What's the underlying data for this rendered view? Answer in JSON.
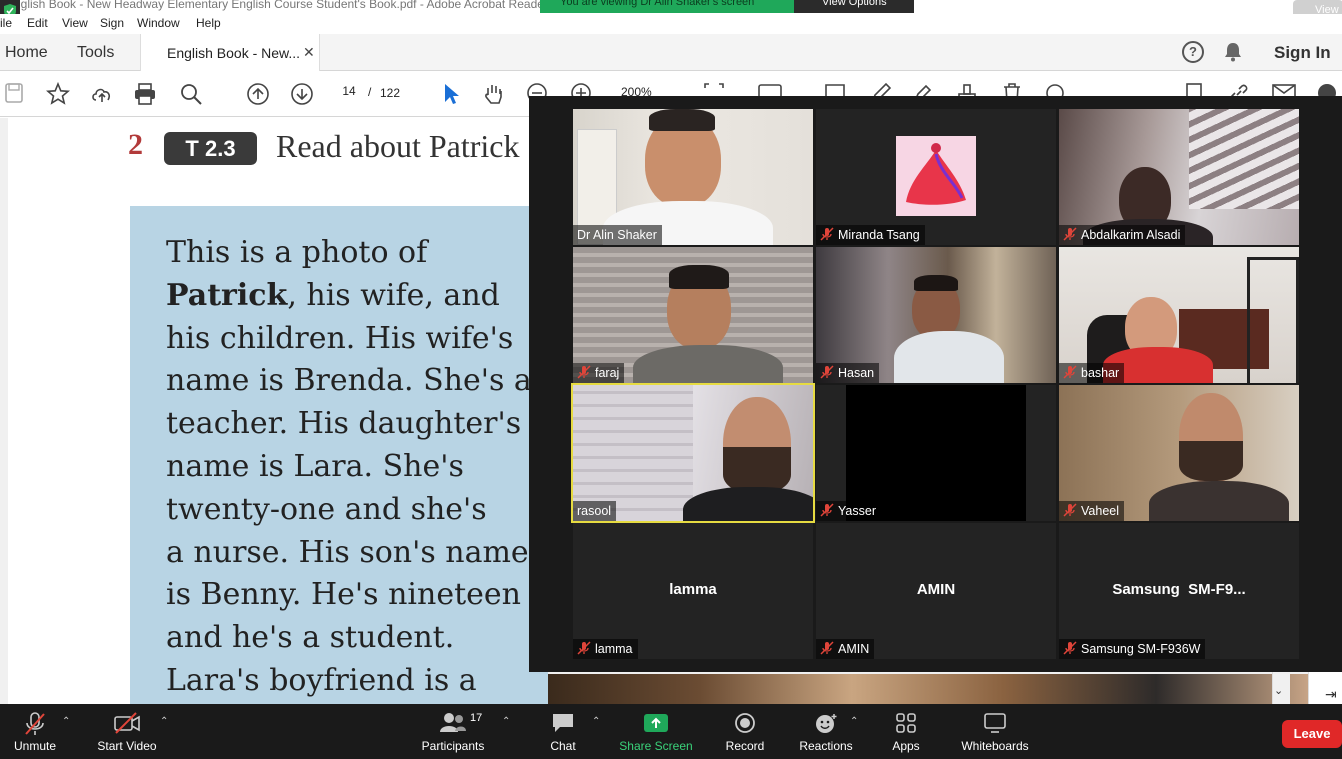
{
  "window": {
    "title": "English Book - New Headway Elementary English Course Student's Book.pdf - Adobe Acrobat Reader",
    "title_visible": "nglish Book - New Headway Elementary English Course Student's Book.pdf - Adobe Acrobat Reade"
  },
  "share_banner": {
    "text": "You are viewing Dr Alin Shaker's screen",
    "view_options": "View Options",
    "view_button": "View"
  },
  "menu": [
    "ile",
    "Edit",
    "View",
    "Sign",
    "Window",
    "Help"
  ],
  "tabs": {
    "home": "Home",
    "tools": "Tools",
    "document": "English Book - New...",
    "sign_in": "Sign In"
  },
  "toolbar": {
    "current_page": "14",
    "separator": "/",
    "total_pages": "122",
    "zoom": "200%"
  },
  "document": {
    "section_number": "2",
    "track": "T 2.3",
    "heading": "Read about Patrick",
    "reading_lines": [
      "This is a photo of",
      "Patrick, his wife, and",
      "his children. His wife's",
      "name is Brenda. She's a",
      "teacher. His daughter's",
      "name is Lara. She's",
      "twenty-one and she's",
      "a nurse. His son's name",
      "is Benny. He's nineteen",
      "and he's a student.",
      "Lara's boyfriend is a"
    ],
    "bold_word": "Patrick"
  },
  "gallery": {
    "participants": [
      {
        "name": "Dr Alin Shaker",
        "muted": false,
        "video": true,
        "active": false
      },
      {
        "name": "Miranda Tsang",
        "muted": true,
        "video": false,
        "avatar": true,
        "active": false
      },
      {
        "name": "Abdalkarim Alsadi",
        "muted": true,
        "video": true,
        "active": false
      },
      {
        "name": "faraj",
        "muted": true,
        "video": true,
        "active": false
      },
      {
        "name": "Hasan",
        "muted": true,
        "video": true,
        "active": false
      },
      {
        "name": "bashar",
        "muted": true,
        "video": true,
        "active": false
      },
      {
        "name": "rasool",
        "muted": false,
        "video": true,
        "active": true
      },
      {
        "name": "Yasser",
        "muted": true,
        "video": "black",
        "active": false
      },
      {
        "name": "Vaheel",
        "muted": true,
        "video": true,
        "active": false
      },
      {
        "name": "lamma",
        "display": "lamma",
        "muted": true,
        "video": false,
        "active": false
      },
      {
        "name": "AMIN",
        "display": "AMIN",
        "muted": true,
        "video": false,
        "active": false
      },
      {
        "name": "Samsung SM-F936W",
        "display": "Samsung  SM-F9...",
        "muted": true,
        "video": false,
        "active": false
      }
    ]
  },
  "zoombar": {
    "unmute": "Unmute",
    "start_video": "Start Video",
    "participants": "Participants",
    "participant_count": "17",
    "chat": "Chat",
    "share_screen": "Share Screen",
    "record": "Record",
    "reactions": "Reactions",
    "apps": "Apps",
    "whiteboards": "Whiteboards",
    "leave": "Leave"
  },
  "colors": {
    "share_green": "#1fa85a",
    "active_speaker": "#e6db41",
    "leave_red": "#e02828",
    "mute_red": "#e0453a",
    "text_box_blue": "#b8d4e4",
    "section_red": "#b23a3a"
  }
}
